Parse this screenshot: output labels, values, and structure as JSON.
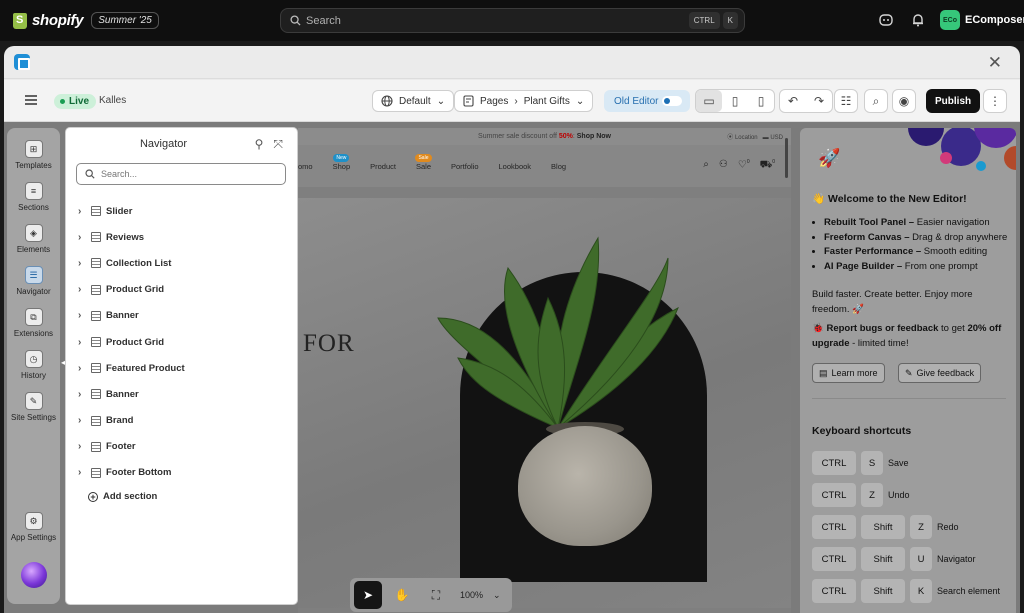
{
  "shopify": {
    "brand": "shopify",
    "edition": "Summer '25",
    "search_placeholder": "Search",
    "shortcut_keys": [
      "CTRL",
      "K"
    ],
    "store_initials": "ECo",
    "store_name": "EComposer"
  },
  "toolbar": {
    "status": "Live",
    "theme": "Kalles",
    "device_select": "Default",
    "page_type": "Pages",
    "page_name": "Plant Gifts",
    "old_editor": "Old Editor",
    "publish": "Publish"
  },
  "rail": {
    "items": [
      {
        "label": "Templates",
        "icon": "templates-icon"
      },
      {
        "label": "Sections",
        "icon": "sections-icon"
      },
      {
        "label": "Elements",
        "icon": "elements-icon"
      },
      {
        "label": "Navigator",
        "icon": "navigator-icon"
      },
      {
        "label": "Extensions",
        "icon": "extensions-icon"
      },
      {
        "label": "History",
        "icon": "history-icon"
      },
      {
        "label": "Site Settings",
        "icon": "site-settings-icon"
      }
    ],
    "app_settings": "App Settings"
  },
  "navigator": {
    "title": "Navigator",
    "search_placeholder": "Search...",
    "sections": [
      "Slider",
      "Reviews",
      "Collection List",
      "Product Grid",
      "Banner",
      "Product Grid",
      "Featured Product",
      "Banner",
      "Brand",
      "Footer",
      "Footer Bottom"
    ],
    "add_section": "Add section"
  },
  "canvas": {
    "announcement": "Summer sale discount off",
    "announcement_pct": "50%",
    "announcement_link": "Shop Now",
    "location": "Location",
    "currency": "USD",
    "menu": [
      {
        "label": "omo",
        "badge": ""
      },
      {
        "label": "Shop",
        "badge": "New"
      },
      {
        "label": "Product",
        "badge": ""
      },
      {
        "label": "Sale",
        "badge": "Sale"
      },
      {
        "label": "Portfolio",
        "badge": ""
      },
      {
        "label": "Lookbook",
        "badge": ""
      },
      {
        "label": "Blog",
        "badge": ""
      }
    ],
    "wishlist_count": "0",
    "cart_count": "0",
    "hero_text": "FOR",
    "zoom": "100%"
  },
  "panel": {
    "title": "Welcome to the New Editor!",
    "features": [
      {
        "bold": "Rebuilt Tool Panel –",
        "rest": " Easier navigation"
      },
      {
        "bold": "Freeform Canvas –",
        "rest": " Drag & drop anywhere"
      },
      {
        "bold": "Faster Performance –",
        "rest": " Smooth editing"
      },
      {
        "bold": "AI Page Builder –",
        "rest": " From one prompt"
      }
    ],
    "tagline": "Build faster. Create better. Enjoy more freedom.",
    "bug_bold": "Report bugs or feedback",
    "bug_rest": " to get ",
    "bug_bold2": "20% off upgrade",
    "bug_tail": " - limited time!",
    "learn_more": "Learn more",
    "give_feedback": "Give feedback",
    "shortcuts_title": "Keyboard shortcuts",
    "shortcuts": [
      {
        "keys": [
          "CTRL",
          "S"
        ],
        "action": "Save"
      },
      {
        "keys": [
          "CTRL",
          "Z"
        ],
        "action": "Undo"
      },
      {
        "keys": [
          "CTRL",
          "Shift",
          "Z"
        ],
        "action": "Redo"
      },
      {
        "keys": [
          "CTRL",
          "Shift",
          "U"
        ],
        "action": "Navigator"
      },
      {
        "keys": [
          "CTRL",
          "Shift",
          "K"
        ],
        "action": "Search element"
      }
    ]
  },
  "colors": {
    "live_green": "#1a9d53",
    "old_editor_blue": "#2870b0",
    "announcement_red": "#b00000",
    "badge_new": "#1e90c8",
    "badge_sale": "#e08a1e"
  }
}
